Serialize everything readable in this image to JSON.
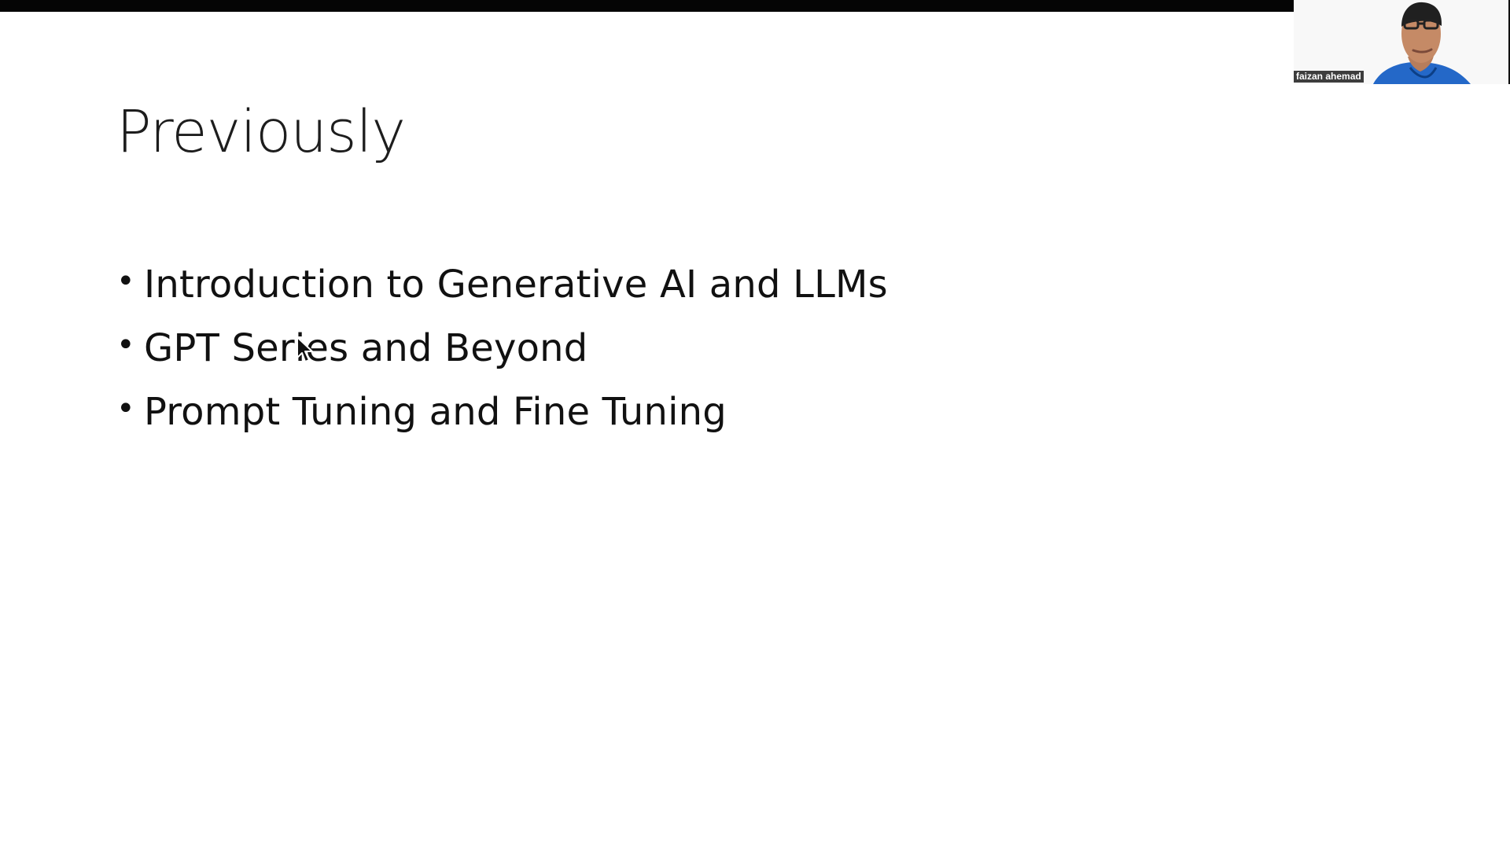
{
  "slide": {
    "title": "Previously",
    "bullets": [
      "Introduction to Generative AI and LLMs",
      "GPT Series and Beyond",
      "Prompt Tuning and Fine Tuning"
    ]
  },
  "participant": {
    "name": "faizan ahemad"
  },
  "icons": {
    "cursor": "mouse-pointer-icon",
    "bullet": "bullet-dot-icon"
  },
  "colors": {
    "background": "#ffffff",
    "text": "#111111",
    "top_bar": "#050505",
    "shirt": "#2468c8"
  }
}
